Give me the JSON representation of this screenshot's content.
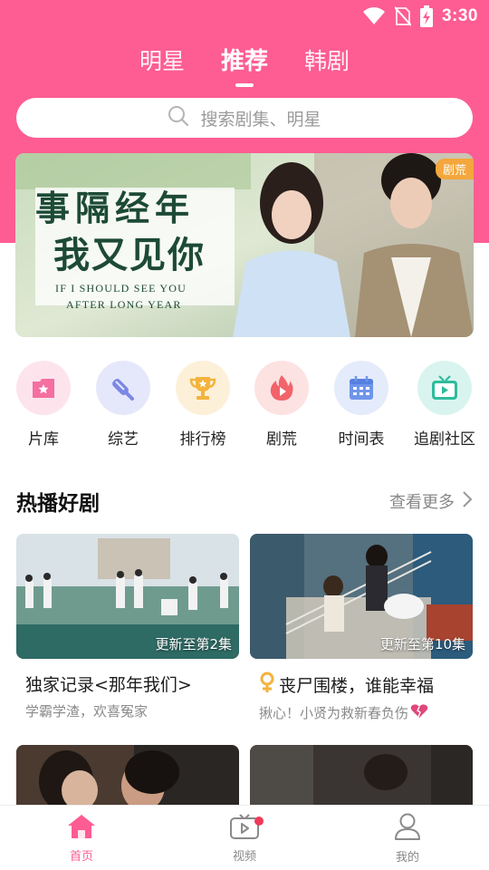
{
  "status_bar": {
    "time": "3:30"
  },
  "top_tabs": [
    {
      "label": "明星",
      "active": false
    },
    {
      "label": "推荐",
      "active": true
    },
    {
      "label": "韩剧",
      "active": false
    }
  ],
  "search": {
    "placeholder": "搜索剧集、明星"
  },
  "banner": {
    "title_line1": "事隔经年",
    "title_line2": "我又见你",
    "en_line1": "IF I SHOULD SEE YOU",
    "en_line2": "AFTER LONG YEAR",
    "tag": "剧荒"
  },
  "categories": [
    {
      "label": "片库",
      "icon": "film-library-icon",
      "bg": "#fde4ec",
      "color": "#f56fa0"
    },
    {
      "label": "综艺",
      "icon": "microphone-icon",
      "bg": "#e5e8fb",
      "color": "#7b87e6"
    },
    {
      "label": "排行榜",
      "icon": "trophy-icon",
      "bg": "#fdf0d9",
      "color": "#f3b33c"
    },
    {
      "label": "剧荒",
      "icon": "flame-icon",
      "bg": "#fde2e2",
      "color": "#f2636a"
    },
    {
      "label": "时间表",
      "icon": "calendar-icon",
      "bg": "#e4ebfb",
      "color": "#6f95ea"
    },
    {
      "label": "追剧社区",
      "icon": "tv-icon",
      "bg": "#d9f4ee",
      "color": "#2fbc9c"
    }
  ],
  "section": {
    "title": "热播好剧",
    "more": "查看更多"
  },
  "cards": [
    {
      "badge": "更新至第2集",
      "title": "独家记录<那年我们>",
      "subtitle": "学霸学渣，欢喜冤家"
    },
    {
      "badge": "更新至第10集",
      "title": "丧尸围楼，谁能幸福",
      "subtitle": "揪心！小贤为救新春负伤",
      "title_icon": "female-symbol-icon",
      "subtitle_icon": "broken-heart-icon"
    }
  ],
  "bottom_nav": [
    {
      "label": "首页",
      "icon": "home-icon",
      "active": true
    },
    {
      "label": "视频",
      "icon": "video-icon",
      "active": false
    },
    {
      "label": "我的",
      "icon": "user-icon",
      "active": false
    }
  ],
  "colors": {
    "brand": "#fd5d93",
    "banner_tag": "#f3a73c"
  }
}
